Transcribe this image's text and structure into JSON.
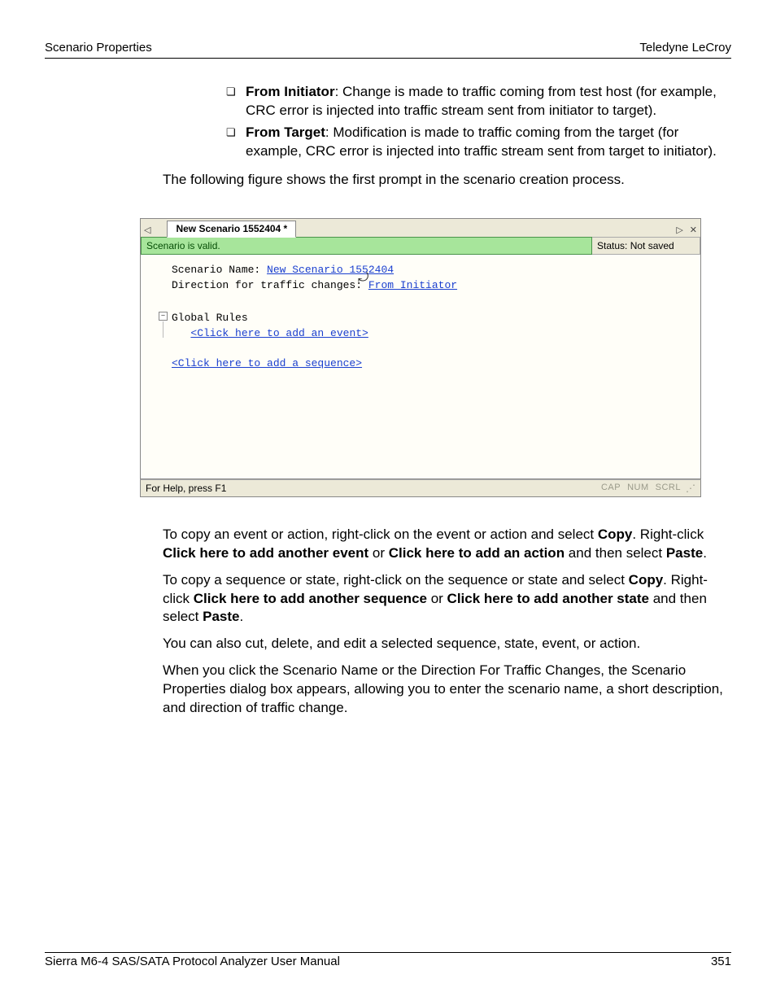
{
  "header": {
    "left": "Scenario Properties",
    "right": "Teledyne LeCroy"
  },
  "bullets": [
    {
      "lead": "From Initiator",
      "rest": ": Change is made to traffic coming from test host (for example, CRC error is injected into traffic stream sent from initiator to target)."
    },
    {
      "lead": "From Target",
      "rest": ": Modification is made to traffic coming from the target (for example, CRC error is injected into traffic stream sent from target to initiator)."
    }
  ],
  "intro": "The following figure shows the first prompt in the scenario creation process.",
  "figure": {
    "tab_title": "New Scenario 1552404 *",
    "nav_left": "◁",
    "nav_right": "▷",
    "close": "✕",
    "valid_msg": "Scenario is valid.",
    "save_status": "Status: Not saved",
    "lbl_scenario_name": "Scenario Name: ",
    "val_scenario_name": "New Scenario 1552404",
    "lbl_direction": "Direction for traffic changes: ",
    "val_direction": "From Initiator",
    "global_rules": "Global Rules",
    "add_event": "<Click here to add an event>",
    "add_sequence": "<Click here to add a sequence>",
    "help_hint": "For Help, press F1",
    "cap": "CAP",
    "num": "NUM",
    "scrl": "SCRL",
    "tree_toggle": "–"
  },
  "paras": {
    "p1a": "To copy an event or action, right-click on the event or action and select ",
    "p1b": "Copy",
    "p1c": ". Right-click ",
    "p1d": "Click here to add another event",
    "p1e": " or ",
    "p1f": "Click here to add an action",
    "p1g": " and then select ",
    "p1h": "Paste",
    "p1i": ".",
    "p2a": "To copy a sequence or state, right-click on the sequence or state and select ",
    "p2b": "Copy",
    "p2c": ". Right-click ",
    "p2d": "Click here to add another sequence",
    "p2e": " or ",
    "p2f": "Click here to add another state",
    "p2g": " and then select ",
    "p2h": "Paste",
    "p2i": ".",
    "p3": "You can also cut, delete, and edit a selected sequence, state, event, or action.",
    "p4": "When you click the Scenario Name or the Direction For Traffic Changes, the Scenario Properties dialog box appears, allowing you to enter the scenario name, a short description, and direction of traffic change."
  },
  "footer": {
    "left": "Sierra M6-4 SAS/SATA Protocol Analyzer User Manual",
    "right": "351"
  }
}
